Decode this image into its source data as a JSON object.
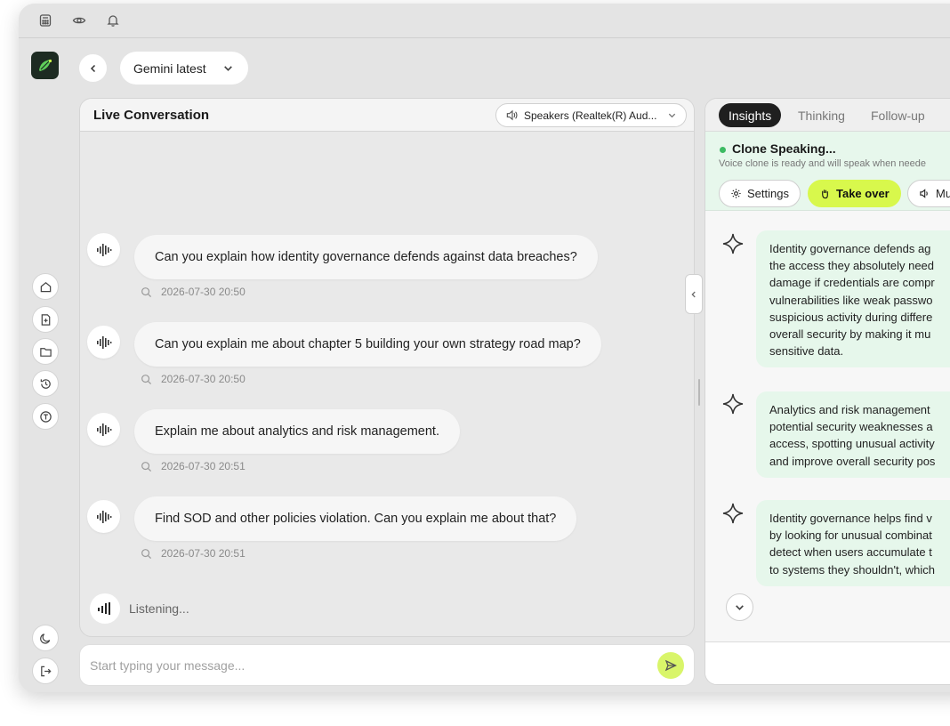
{
  "header": {
    "model_label": "Gemini latest"
  },
  "conversation": {
    "title": "Live Conversation",
    "speaker_device": "Speakers (Realtek(R) Aud...",
    "messages": [
      {
        "text": "Can you explain how identity governance defends against data breaches?",
        "timestamp": "2026-07-30 20:50"
      },
      {
        "text": "Can you explain me about chapter 5 building your own strategy road map?",
        "timestamp": "2026-07-30 20:50"
      },
      {
        "text": "Explain me about analytics and risk management.",
        "timestamp": "2026-07-30 20:51"
      },
      {
        "text": "Find SOD and other policies violation. Can you explain me about that?",
        "timestamp": "2026-07-30 20:51"
      }
    ],
    "listening_label": "Listening...",
    "input_placeholder": "Start typing your message..."
  },
  "insights": {
    "tabs": [
      {
        "label": "Insights",
        "active": true
      },
      {
        "label": "Thinking",
        "active": false
      },
      {
        "label": "Follow-up",
        "active": false
      }
    ],
    "voice": {
      "title": "Clone Speaking...",
      "subtitle": "Voice clone is ready and will speak when neede",
      "settings_label": "Settings",
      "takeover_label": "Take over",
      "mute_label": "Mu"
    },
    "cards": [
      {
        "lines": [
          "Identity governance defends ag",
          "the access they absolutely need",
          "damage if credentials are compr",
          "vulnerabilities like weak passwo",
          "suspicious activity during differe",
          "overall security by making it mu",
          "sensitive data."
        ]
      },
      {
        "lines": [
          "Analytics and risk management",
          "potential security weaknesses a",
          "access, spotting unusual activity",
          "and improve overall security pos"
        ]
      },
      {
        "lines": [
          "Identity governance helps find v",
          "by looking for unusual combinat",
          "detect when users accumulate t",
          "to systems they shouldn't, which"
        ]
      }
    ]
  },
  "colors": {
    "accent_lime": "#d8f84c",
    "status_green": "#3dbb63",
    "insight_bg": "#e6f7eb"
  }
}
